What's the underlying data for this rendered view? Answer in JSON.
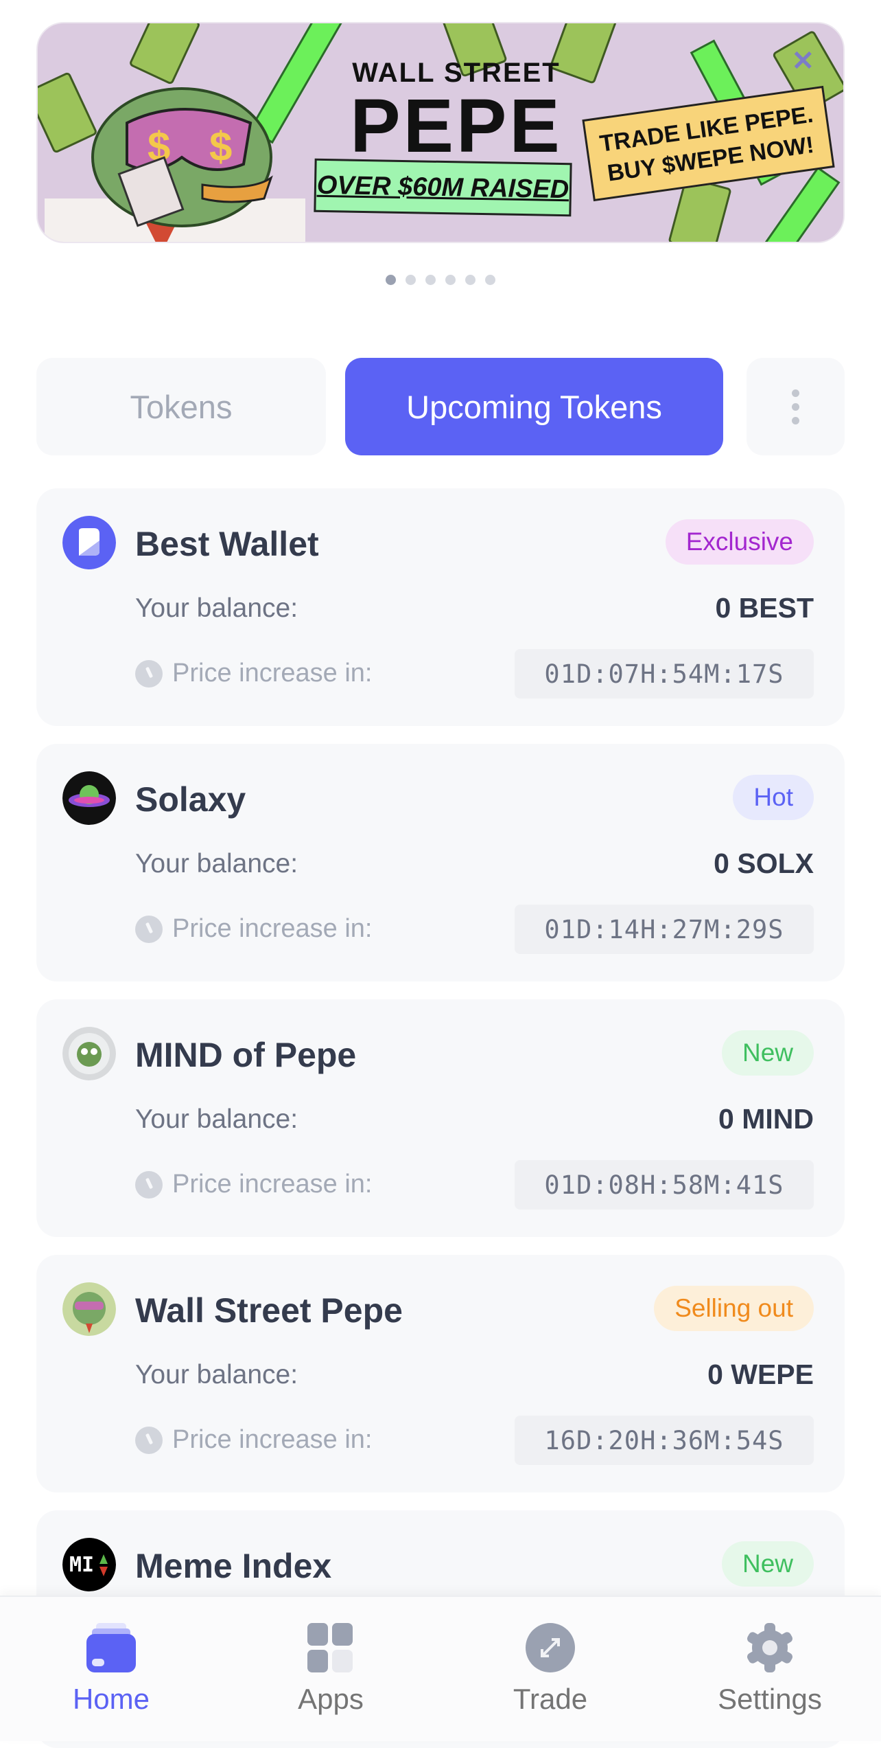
{
  "banner": {
    "line1": "WALL STREET",
    "line2": "PEPE",
    "raised": "OVER $60M RAISED",
    "cta_line1": "TRADE LIKE PEPE.",
    "cta_line2": "BUY $WEPE NOW!",
    "close": "✕",
    "slides": 6,
    "active_slide": 0
  },
  "tabs": [
    {
      "label": "Tokens",
      "active": false
    },
    {
      "label": "Upcoming Tokens",
      "active": true
    }
  ],
  "tokens": [
    {
      "name": "Best Wallet",
      "badge": "Exclusive",
      "badge_color": "#a327cf",
      "badge_bg": "#f6e0f8",
      "balance_label": "Your balance:",
      "balance": "0 BEST",
      "price_label": "Price increase in:",
      "timer": "01D:07H:54M:17S",
      "icon": "best-wallet-logo"
    },
    {
      "name": "Solaxy",
      "badge": "Hot",
      "badge_color": "#5b62f4",
      "badge_bg": "#e7e9fd",
      "balance_label": "Your balance:",
      "balance": "0 SOLX",
      "price_label": "Price increase in:",
      "timer": "01D:14H:27M:29S",
      "icon": "solaxy-logo"
    },
    {
      "name": "MIND of Pepe",
      "badge": "New",
      "badge_color": "#3fbf5f",
      "badge_bg": "#e6f8ea",
      "balance_label": "Your balance:",
      "balance": "0 MIND",
      "price_label": "Price increase in:",
      "timer": "01D:08H:58M:41S",
      "icon": "mind-of-pepe-logo"
    },
    {
      "name": "Wall Street Pepe",
      "badge": "Selling out",
      "badge_color": "#f08a1c",
      "badge_bg": "#fdefd9",
      "balance_label": "Your balance:",
      "balance": "0 WEPE",
      "price_label": "Price increase in:",
      "timer": "16D:20H:36M:54S",
      "icon": "wall-street-pepe-logo"
    },
    {
      "name": "Meme Index",
      "badge": "New",
      "badge_color": "#3fbf5f",
      "badge_bg": "#e6f8ea",
      "icon": "meme-index-logo",
      "icon_text": "MI"
    }
  ],
  "nav": [
    {
      "label": "Home",
      "active": true,
      "icon": "wallet-icon"
    },
    {
      "label": "Apps",
      "active": false,
      "icon": "apps-grid-icon"
    },
    {
      "label": "Trade",
      "active": false,
      "icon": "trade-swap-icon"
    },
    {
      "label": "Settings",
      "active": false,
      "icon": "gear-icon"
    }
  ],
  "colors": {
    "accent": "#5b62f4",
    "inactive": "#9aa1b1"
  }
}
